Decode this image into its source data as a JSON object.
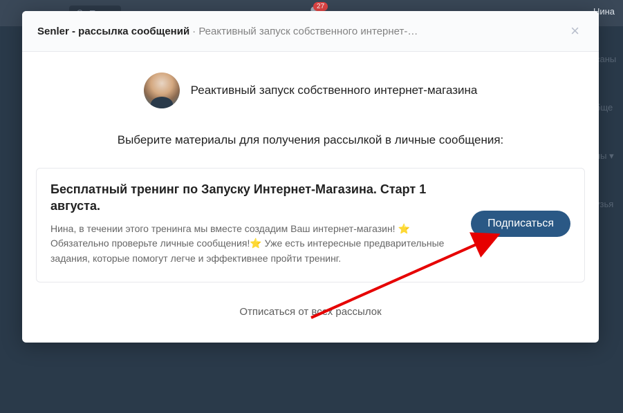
{
  "topbar": {
    "search_placeholder": "Поиск",
    "notification_count": "27",
    "user_name": "Нина"
  },
  "modal": {
    "title_strong": "Senler - рассылка сообщений",
    "title_rest": " · Реактивный запуск собственного интернет-…",
    "author_name": "Реактивный запуск собственного интернет-магазина",
    "instruction": "Выберите материалы для получения рассылкой в личные сообщения:",
    "card": {
      "title": "Бесплатный тренинг по Запуску Интернет-Магазина. Старт 1 августа.",
      "description": "Нина, в течении этого тренинга мы вместе создадим Ваш интернет-магазин! ⭐ Обязательно проверьте личные сообщения!⭐  Уже есть интересные предварительные задания, которые помогут легче и эффективнее пройти тренинг.",
      "subscribe_label": "Подписаться"
    },
    "unsubscribe_label": "Отписаться от всех рассылок"
  },
  "bg_hints": {
    "h1": "саны",
    "h2": "бще",
    "h3": "ны ▾",
    "h4": "узья"
  }
}
